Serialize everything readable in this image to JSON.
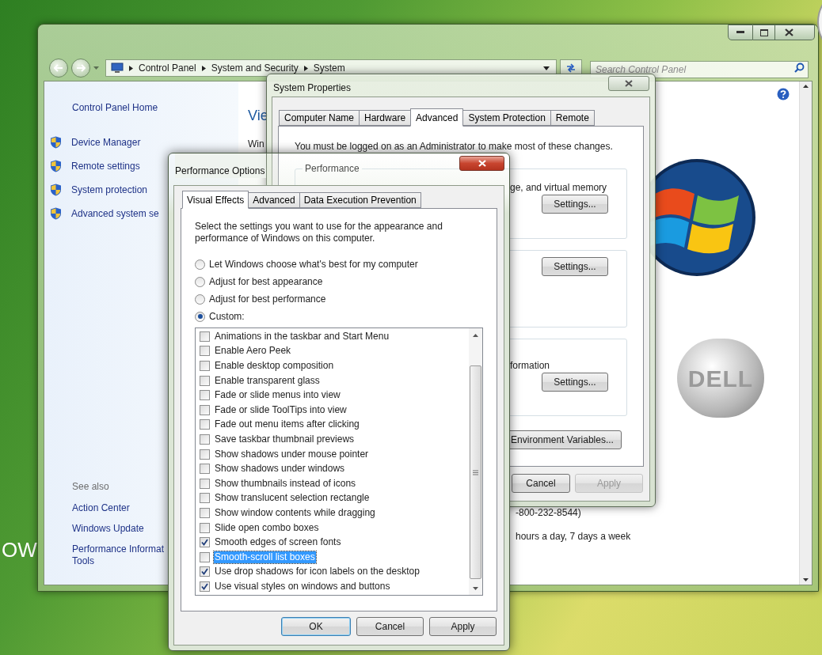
{
  "desktop": {
    "text": "OW"
  },
  "explorer": {
    "address": [
      "Control Panel",
      "System and Security",
      "System"
    ],
    "search": {
      "placeholder": "Search Control Panel"
    },
    "sidebar": {
      "home": "Control Panel Home",
      "tasks": [
        "Device Manager",
        "Remote settings",
        "System protection",
        "Advanced system se"
      ],
      "see_also_heading": "See also",
      "see_also": [
        {
          "lines": [
            "Action Center"
          ]
        },
        {
          "lines": [
            "Windows Update"
          ]
        },
        {
          "lines": [
            "Performance Informat",
            "Tools"
          ]
        }
      ]
    },
    "content": {
      "heading": "Vie",
      "text": "Win",
      "logo_text": "DELL",
      "phone": "-800-232-8544)",
      "hours": "hours a day, 7 days a week"
    }
  },
  "system_properties": {
    "title": "System Properties",
    "tabs": [
      {
        "label": "Computer Name",
        "selected": false
      },
      {
        "label": "Hardware",
        "selected": false
      },
      {
        "label": "Advanced",
        "selected": true
      },
      {
        "label": "System Protection",
        "selected": false
      },
      {
        "label": "Remote",
        "selected": false
      }
    ],
    "notice": "You must be logged on as an Administrator to make most of these changes.",
    "groups": [
      {
        "label": "Performance",
        "text": "ge, and virtual memory",
        "button": "Settings..."
      },
      {
        "button": "Settings..."
      },
      {
        "text": "formation",
        "button": "Settings..."
      }
    ],
    "env_button": "Environment Variables...",
    "buttons": [
      {
        "label": "Cancel",
        "disabled": false
      },
      {
        "label": "Apply",
        "disabled": true
      }
    ]
  },
  "performance_options": {
    "title": "Performance Options",
    "tabs": [
      {
        "label": "Visual Effects",
        "selected": true
      },
      {
        "label": "Advanced",
        "selected": false
      },
      {
        "label": "Data Execution Prevention",
        "selected": false
      }
    ],
    "description": "Select the settings you want to use for the appearance and performance of Windows on this computer.",
    "radios": [
      {
        "label": "Let Windows choose what's best for my computer",
        "selected": false
      },
      {
        "label": "Adjust for best appearance",
        "selected": false
      },
      {
        "label": "Adjust for best performance",
        "selected": false
      },
      {
        "label": "Custom:",
        "selected": true
      }
    ],
    "effects": [
      {
        "label": "Animations in the taskbar and Start Menu",
        "checked": false,
        "selected": false
      },
      {
        "label": "Enable Aero Peek",
        "checked": false,
        "selected": false
      },
      {
        "label": "Enable desktop composition",
        "checked": false,
        "selected": false
      },
      {
        "label": "Enable transparent glass",
        "checked": false,
        "selected": false
      },
      {
        "label": "Fade or slide menus into view",
        "checked": false,
        "selected": false
      },
      {
        "label": "Fade or slide ToolTips into view",
        "checked": false,
        "selected": false
      },
      {
        "label": "Fade out menu items after clicking",
        "checked": false,
        "selected": false
      },
      {
        "label": "Save taskbar thumbnail previews",
        "checked": false,
        "selected": false
      },
      {
        "label": "Show shadows under mouse pointer",
        "checked": false,
        "selected": false
      },
      {
        "label": "Show shadows under windows",
        "checked": false,
        "selected": false
      },
      {
        "label": "Show thumbnails instead of icons",
        "checked": false,
        "selected": false
      },
      {
        "label": "Show translucent selection rectangle",
        "checked": false,
        "selected": false
      },
      {
        "label": "Show window contents while dragging",
        "checked": false,
        "selected": false
      },
      {
        "label": "Slide open combo boxes",
        "checked": false,
        "selected": false
      },
      {
        "label": "Smooth edges of screen fonts",
        "checked": true,
        "selected": false
      },
      {
        "label": "Smooth-scroll list boxes",
        "checked": false,
        "selected": true
      },
      {
        "label": "Use drop shadows for icon labels on the desktop",
        "checked": true,
        "selected": false
      },
      {
        "label": "Use visual styles on windows and buttons",
        "checked": true,
        "selected": false
      }
    ],
    "buttons": [
      {
        "label": "OK",
        "default": true
      },
      {
        "label": "Cancel",
        "default": false
      },
      {
        "label": "Apply",
        "default": false
      }
    ]
  }
}
